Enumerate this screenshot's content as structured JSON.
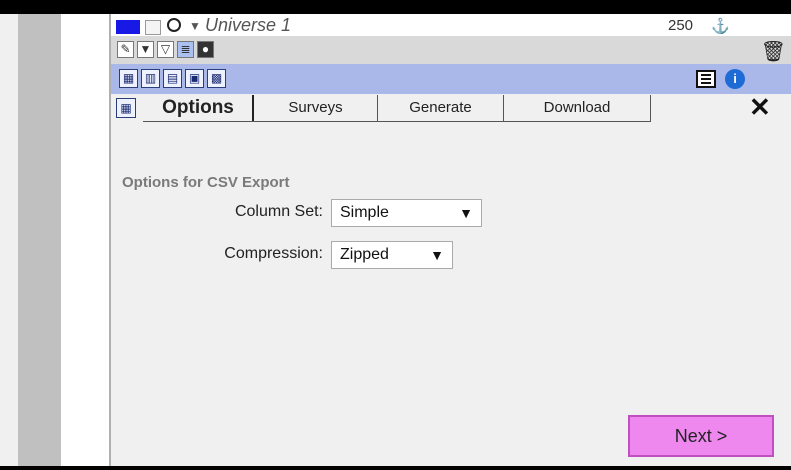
{
  "header": {
    "universe_title": "Universe 1",
    "count": "250"
  },
  "tabs": [
    {
      "label": "Options",
      "active": true
    },
    {
      "label": "Surveys",
      "active": false
    },
    {
      "label": "Generate",
      "active": false
    },
    {
      "label": "Download",
      "active": false
    }
  ],
  "options": {
    "section_title": "Options for CSV Export",
    "column_set_label": "Column Set:",
    "column_set_value": "Simple",
    "compression_label": "Compression:",
    "compression_value": "Zipped"
  },
  "footer": {
    "next_label": "Next >"
  },
  "colors": {
    "accent_blue": "#1919e6",
    "toolbar_blue": "#a9b8e8",
    "next_button": "#ee88ee"
  }
}
